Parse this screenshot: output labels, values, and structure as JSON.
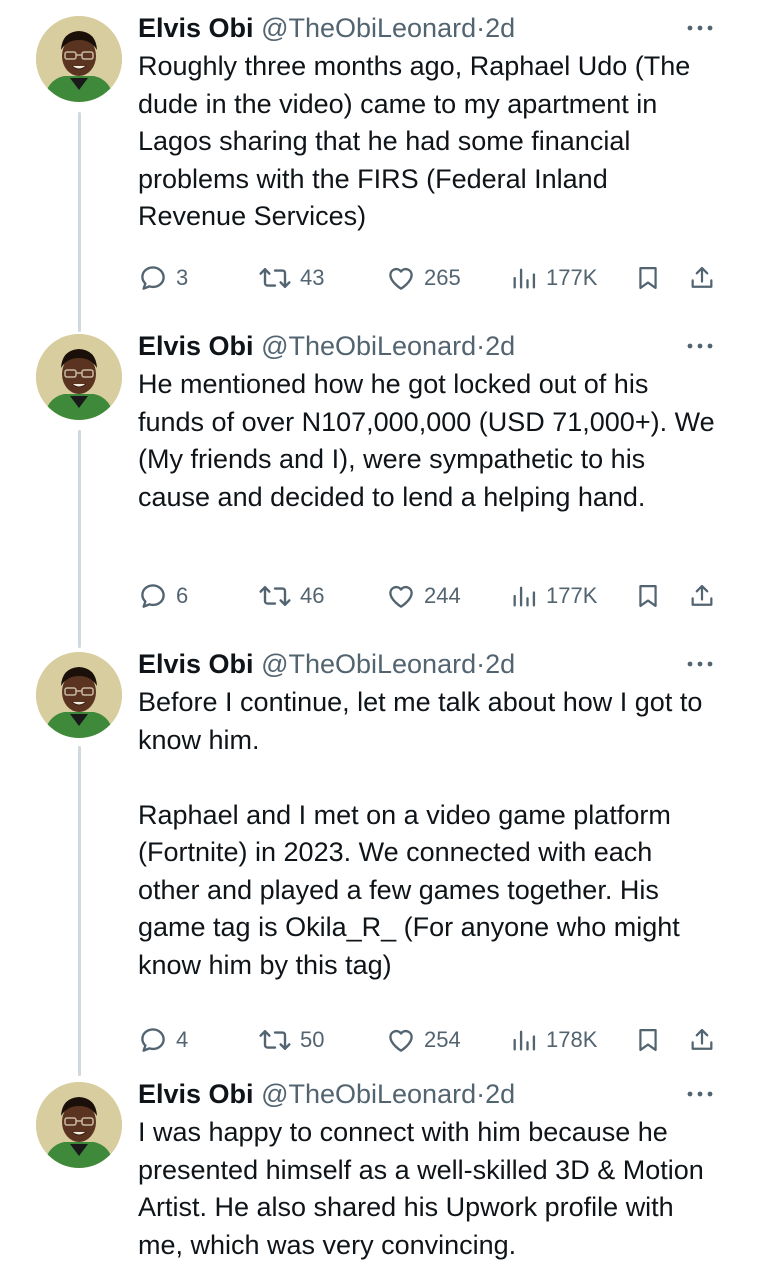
{
  "tweets": [
    {
      "name": "Elvis Obi",
      "handle": "@TheObiLeonard",
      "separator": "·",
      "time": "2d",
      "text": "Roughly three months ago, Raphael Udo (The dude in the video) came to my apartment in Lagos sharing that he had some financial problems with the FIRS (Federal Inland Revenue Services)",
      "replies": "3",
      "reposts": "43",
      "likes": "265",
      "views": "177K"
    },
    {
      "name": "Elvis Obi",
      "handle": "@TheObiLeonard",
      "separator": "·",
      "time": "2d",
      "text": "He mentioned how he got locked out of his funds of over N107,000,000 (USD 71,000+). We (My friends and I), were sympathetic to his cause and decided to lend a helping hand.",
      "replies": "6",
      "reposts": "46",
      "likes": "244",
      "views": "177K"
    },
    {
      "name": "Elvis Obi",
      "handle": "@TheObiLeonard",
      "separator": "·",
      "time": "2d",
      "text": "Before I continue, let me talk about how I got to know him.\n\nRaphael and I met on a video game platform (Fortnite) in 2023. We connected with each other and played a few games together. His game tag is Okila_R_ (For anyone who might know him by this tag)",
      "replies": "4",
      "reposts": "50",
      "likes": "254",
      "views": "178K"
    },
    {
      "name": "Elvis Obi",
      "handle": "@TheObiLeonard",
      "separator": "·",
      "time": "2d",
      "text": "I was happy to connect with him because he presented himself as a well-skilled 3D & Motion Artist. He also shared his Upwork profile with me, which was very convincing."
    }
  ],
  "icons": {
    "reply": "reply-icon",
    "repost": "repost-icon",
    "like": "heart-icon",
    "views": "views-icon",
    "bookmark": "bookmark-icon",
    "share": "share-icon",
    "more": "more-icon"
  },
  "colors": {
    "text": "#0f1419",
    "muted": "#536471",
    "thread_line": "#cfd9de",
    "background": "#ffffff"
  }
}
